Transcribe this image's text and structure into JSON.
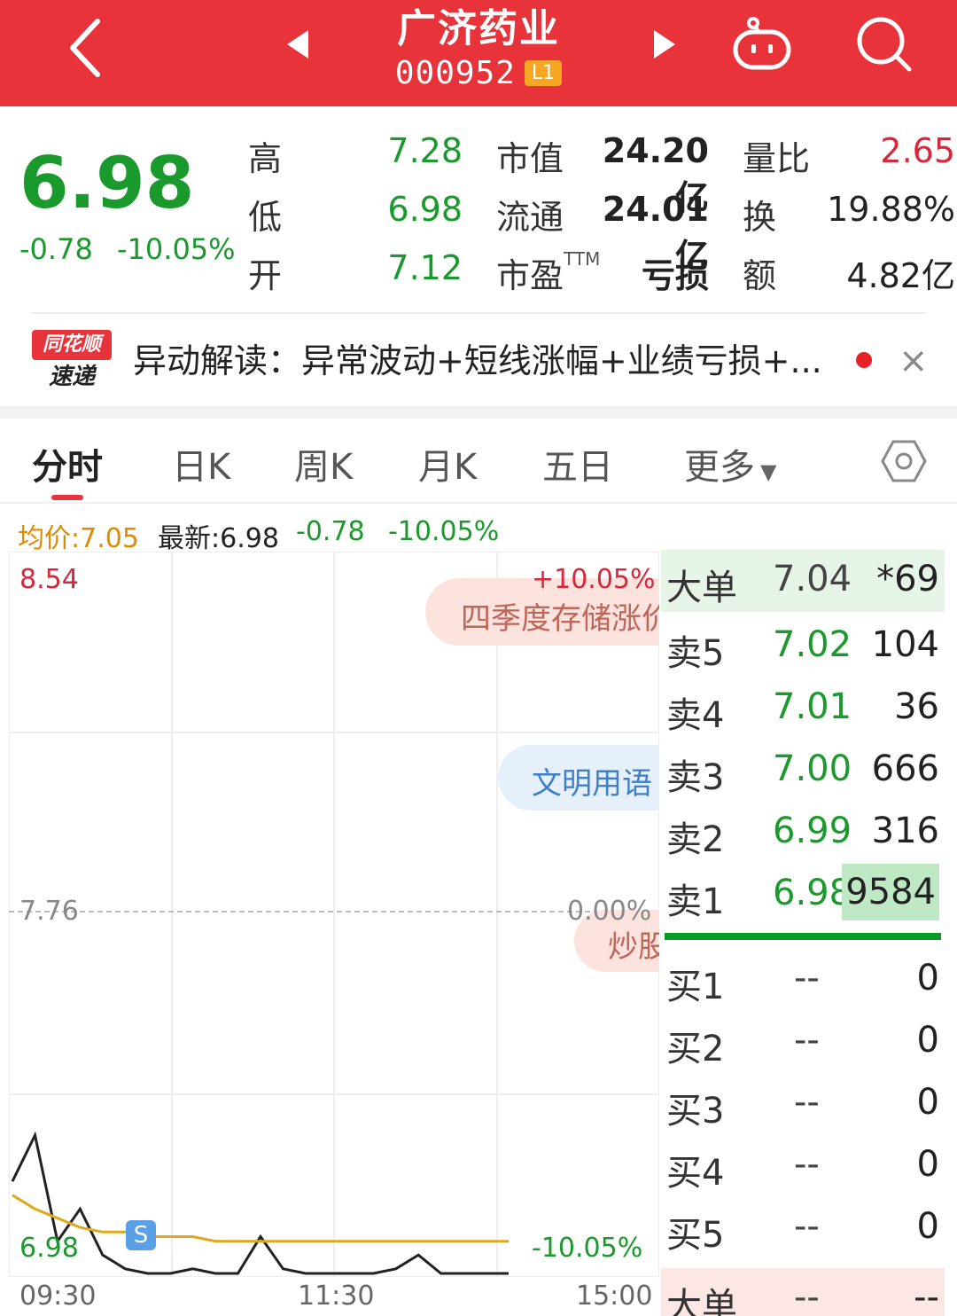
{
  "header": {
    "stock_name": "广济药业",
    "stock_code": "000952",
    "level": "L1"
  },
  "quote": {
    "price": "6.98",
    "change": "-0.78",
    "change_pct": "-10.05%",
    "high_label": "高",
    "high": "7.28",
    "low_label": "低",
    "low": "6.98",
    "open_label": "开",
    "open": "7.12",
    "mcap_label": "市值",
    "mcap": "24.20亿",
    "float_label": "流通",
    "float": "24.01亿",
    "pe_label": "市盈",
    "pe_sup": "TTM",
    "pe": "亏损",
    "vol_ratio_label": "量比",
    "vol_ratio": "2.65",
    "turnover_label": "换",
    "turnover": "19.88%",
    "amount_label": "额",
    "amount": "4.82亿"
  },
  "news": {
    "logo_top": "同花顺",
    "logo_bottom": "速递",
    "text": "异动解读：异常波动+短线涨幅+业绩亏损+...",
    "close": "×"
  },
  "tabs": [
    "分时",
    "日K",
    "周K",
    "月K",
    "五日",
    "更多"
  ],
  "info_row": {
    "avg": "均价:7.05",
    "latest": "最新:6.98",
    "change": "-0.78",
    "change_pct": "-10.05%"
  },
  "chart": {
    "top_price": "8.54",
    "top_pct": "+10.05%",
    "mid_price": "7.76",
    "mid_pct": "0.00%",
    "bottom_price": "6.98",
    "bottom_pct": "-10.05%",
    "times": [
      "09:30",
      "11:30",
      "15:00"
    ],
    "marker": "S",
    "bubble1": "四季度存储涨价",
    "bubble2": "文明用语",
    "bubble3": "炒股"
  },
  "chart_data": {
    "type": "line",
    "x": [
      "09:30",
      "11:30",
      "15:00"
    ],
    "ylim": [
      6.98,
      8.54
    ],
    "series": [
      {
        "name": "最新",
        "color": "#222222",
        "values": [
          7.18,
          7.28,
          7.05,
          7.12,
          7.02,
          6.99,
          6.98,
          6.98,
          6.99,
          6.98,
          6.98,
          7.06,
          6.99,
          6.98,
          6.98,
          6.98,
          6.98,
          6.99,
          7.02,
          6.98,
          6.98,
          6.98,
          6.98
        ]
      },
      {
        "name": "均价",
        "color": "#e0a81c",
        "values": [
          7.15,
          7.12,
          7.1,
          7.08,
          7.07,
          7.07,
          7.06,
          7.06,
          7.06,
          7.05,
          7.05,
          7.05,
          7.05,
          7.05,
          7.05,
          7.05,
          7.05,
          7.05,
          7.05,
          7.05,
          7.05,
          7.05,
          7.05
        ]
      }
    ]
  },
  "orderbook": {
    "big_label": "大单",
    "big_price": "7.04",
    "big_vol": "*69",
    "asks": [
      {
        "label": "卖5",
        "price": "7.02",
        "vol": "104"
      },
      {
        "label": "卖4",
        "price": "7.01",
        "vol": "36"
      },
      {
        "label": "卖3",
        "price": "7.00",
        "vol": "666"
      },
      {
        "label": "卖2",
        "price": "6.99",
        "vol": "316"
      },
      {
        "label": "卖1",
        "price": "6.98",
        "vol": "9584"
      }
    ],
    "bids": [
      {
        "label": "买1",
        "price": "--",
        "vol": "0"
      },
      {
        "label": "买2",
        "price": "--",
        "vol": "0"
      },
      {
        "label": "买3",
        "price": "--",
        "vol": "0"
      },
      {
        "label": "买4",
        "price": "--",
        "vol": "0"
      },
      {
        "label": "买5",
        "price": "--",
        "vol": "0"
      }
    ],
    "big2_label": "大单",
    "big2_price": "--",
    "big2_vol": "--"
  }
}
